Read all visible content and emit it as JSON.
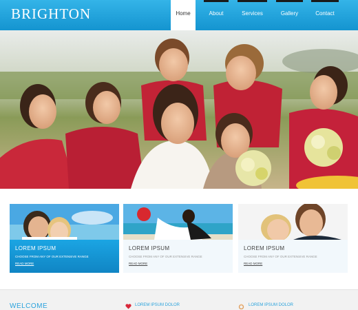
{
  "brand": {
    "logo_text": "Brighton"
  },
  "nav": {
    "items": [
      {
        "label": "Home",
        "active": true
      },
      {
        "label": "About",
        "active": false
      },
      {
        "label": "Services",
        "active": false
      },
      {
        "label": "Gallery",
        "active": false
      },
      {
        "label": "Contact",
        "active": false
      }
    ]
  },
  "hero": {
    "image": "bridesmaids-group-photo"
  },
  "cards": [
    {
      "title": "LOREM IPSUM",
      "subtitle": "CHOOSE FROM ANY OF OUR EXTENSIVE RANGE",
      "link": "READ MORE",
      "image": "couple-beach-photo"
    },
    {
      "title": "LOREM IPSUM",
      "subtitle": "CHOOSE FROM ANY OF OUR EXTENSIVE RANGE",
      "link": "READ MORE",
      "image": "couple-dip-kiss-photo"
    },
    {
      "title": "LOREM IPSUM",
      "subtitle": "CHOOSE FROM ANY OF OUR EXTENSIVE RANGE",
      "link": "READ MORE",
      "image": "couple-portrait-photo"
    }
  ],
  "bottom": {
    "welcome": "WELCOME",
    "items": [
      {
        "label": "LOREM IPSUM DOLOR",
        "icon": "heart-icon"
      },
      {
        "label": "LOREM IPSUM DOLOR",
        "icon": "ring-icon"
      }
    ]
  },
  "colors": {
    "header_blue": "#1ba5e3",
    "accent_blue": "#2aa2dc",
    "nav_bar": "#1a1a1a"
  }
}
